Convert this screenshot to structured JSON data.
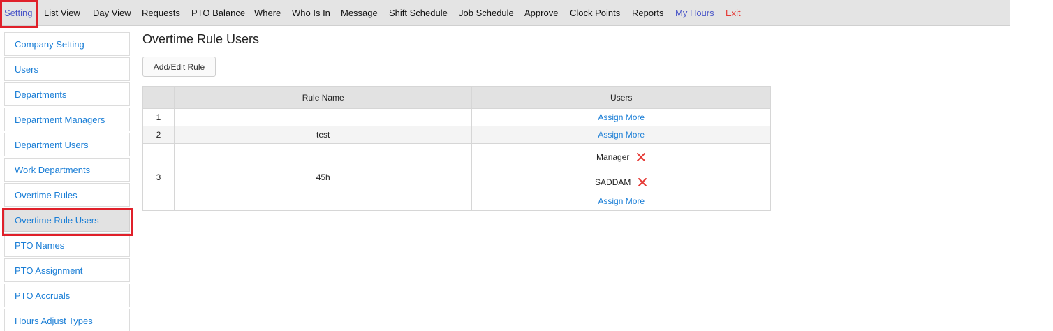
{
  "nav": {
    "items": [
      {
        "label": "Setting"
      },
      {
        "label": "List View"
      },
      {
        "label": "Day View"
      },
      {
        "label": "Requests"
      },
      {
        "label": "PTO Balance"
      },
      {
        "label": "Where"
      },
      {
        "label": "Who Is In"
      },
      {
        "label": "Message"
      },
      {
        "label": "Shift Schedule"
      },
      {
        "label": "Job Schedule"
      },
      {
        "label": "Approve"
      },
      {
        "label": "Clock Points"
      },
      {
        "label": "Reports"
      },
      {
        "label": "My Hours"
      },
      {
        "label": "Exit"
      }
    ],
    "active": "Setting"
  },
  "sidebar": {
    "items": [
      {
        "label": "Company Setting"
      },
      {
        "label": "Users"
      },
      {
        "label": "Departments"
      },
      {
        "label": "Department Managers"
      },
      {
        "label": "Department Users"
      },
      {
        "label": "Work Departments"
      },
      {
        "label": "Overtime Rules"
      },
      {
        "label": "Overtime Rule Users"
      },
      {
        "label": "PTO Names"
      },
      {
        "label": "PTO Assignment"
      },
      {
        "label": "PTO Accruals"
      },
      {
        "label": "Hours Adjust Types"
      }
    ],
    "active": "Overtime Rule Users"
  },
  "page": {
    "title": "Overtime Rule Users",
    "add_edit_label": "Add/Edit Rule"
  },
  "table": {
    "headers": {
      "index": "",
      "rule_name": "Rule Name",
      "users": "Users"
    },
    "rows": [
      {
        "index": "1",
        "rule_name": "",
        "users": [],
        "assign_label": "Assign More"
      },
      {
        "index": "2",
        "rule_name": "test",
        "users": [],
        "assign_label": "Assign More"
      },
      {
        "index": "3",
        "rule_name": "45h",
        "users": [
          {
            "name": "Manager"
          },
          {
            "name": "SADDAM"
          }
        ],
        "assign_label": "Assign More"
      }
    ]
  },
  "colors": {
    "link": "#1a7ed6",
    "highlight": "#e0202a",
    "remove": "#e53935",
    "active_nav": "#4a56c8"
  },
  "icons": {
    "remove_user": "close-icon"
  }
}
